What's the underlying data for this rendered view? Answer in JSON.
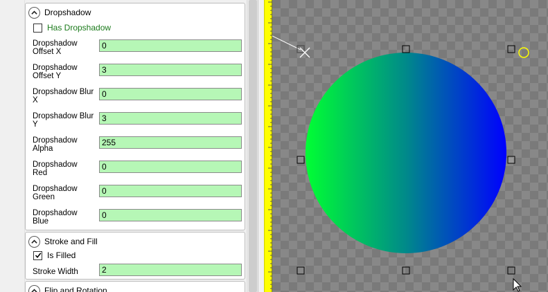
{
  "dropshadow": {
    "title": "Dropshadow",
    "has_dropshadow_label": "Has Dropshadow",
    "fields": [
      {
        "label_line1": "Dropshadow",
        "label_line2": "Offset X",
        "value": "0"
      },
      {
        "label_line1": "Dropshadow",
        "label_line2": "Offset Y",
        "value": "3"
      },
      {
        "label_line1": "Dropshadow Blur",
        "label_line2": "X",
        "value": "0"
      },
      {
        "label_line1": "Dropshadow Blur",
        "label_line2": "Y",
        "value": "3"
      },
      {
        "label_line1": "Dropshadow",
        "label_line2": "Alpha",
        "value": "255"
      },
      {
        "label_line1": "Dropshadow",
        "label_line2": "Red",
        "value": "0"
      },
      {
        "label_line1": "Dropshadow",
        "label_line2": "Green",
        "value": "0"
      },
      {
        "label_line1": "Dropshadow",
        "label_line2": "Blue",
        "value": "0"
      }
    ]
  },
  "stroke_fill": {
    "title": "Stroke and Fill",
    "is_filled_label": "Is Filled",
    "stroke_width_label": "Stroke Width",
    "stroke_width_value": "2"
  },
  "flip_rotation": {
    "title": "Flip and Rotation"
  },
  "canvas": {
    "gradient_start": "#00ff33",
    "gradient_mid": "#00898a",
    "gradient_end": "#0000ff"
  },
  "colors": {
    "input_bg": "#b6f7b6",
    "ruler": "#ffff00",
    "label_green": "#1a7a1a"
  }
}
